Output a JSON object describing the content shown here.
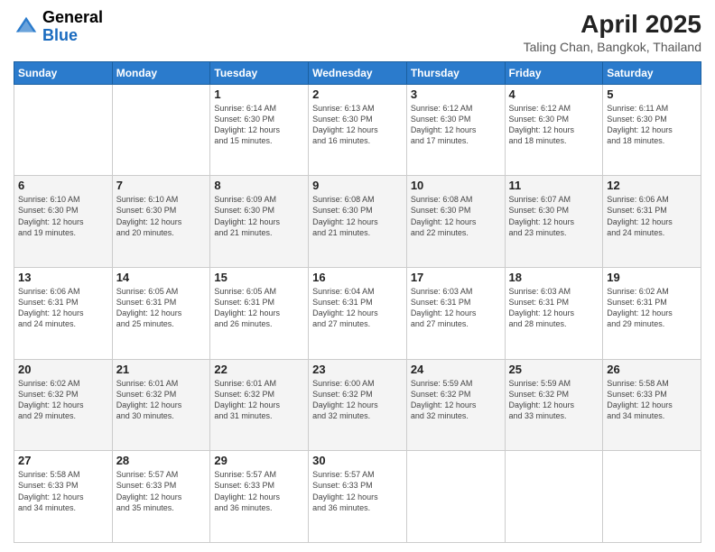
{
  "header": {
    "logo_line1": "General",
    "logo_line2": "Blue",
    "title": "April 2025",
    "subtitle": "Taling Chan, Bangkok, Thailand"
  },
  "days_of_week": [
    "Sunday",
    "Monday",
    "Tuesday",
    "Wednesday",
    "Thursday",
    "Friday",
    "Saturday"
  ],
  "weeks": [
    [
      {
        "day": "",
        "info": ""
      },
      {
        "day": "",
        "info": ""
      },
      {
        "day": "1",
        "info": "Sunrise: 6:14 AM\nSunset: 6:30 PM\nDaylight: 12 hours\nand 15 minutes."
      },
      {
        "day": "2",
        "info": "Sunrise: 6:13 AM\nSunset: 6:30 PM\nDaylight: 12 hours\nand 16 minutes."
      },
      {
        "day": "3",
        "info": "Sunrise: 6:12 AM\nSunset: 6:30 PM\nDaylight: 12 hours\nand 17 minutes."
      },
      {
        "day": "4",
        "info": "Sunrise: 6:12 AM\nSunset: 6:30 PM\nDaylight: 12 hours\nand 18 minutes."
      },
      {
        "day": "5",
        "info": "Sunrise: 6:11 AM\nSunset: 6:30 PM\nDaylight: 12 hours\nand 18 minutes."
      }
    ],
    [
      {
        "day": "6",
        "info": "Sunrise: 6:10 AM\nSunset: 6:30 PM\nDaylight: 12 hours\nand 19 minutes."
      },
      {
        "day": "7",
        "info": "Sunrise: 6:10 AM\nSunset: 6:30 PM\nDaylight: 12 hours\nand 20 minutes."
      },
      {
        "day": "8",
        "info": "Sunrise: 6:09 AM\nSunset: 6:30 PM\nDaylight: 12 hours\nand 21 minutes."
      },
      {
        "day": "9",
        "info": "Sunrise: 6:08 AM\nSunset: 6:30 PM\nDaylight: 12 hours\nand 21 minutes."
      },
      {
        "day": "10",
        "info": "Sunrise: 6:08 AM\nSunset: 6:30 PM\nDaylight: 12 hours\nand 22 minutes."
      },
      {
        "day": "11",
        "info": "Sunrise: 6:07 AM\nSunset: 6:30 PM\nDaylight: 12 hours\nand 23 minutes."
      },
      {
        "day": "12",
        "info": "Sunrise: 6:06 AM\nSunset: 6:31 PM\nDaylight: 12 hours\nand 24 minutes."
      }
    ],
    [
      {
        "day": "13",
        "info": "Sunrise: 6:06 AM\nSunset: 6:31 PM\nDaylight: 12 hours\nand 24 minutes."
      },
      {
        "day": "14",
        "info": "Sunrise: 6:05 AM\nSunset: 6:31 PM\nDaylight: 12 hours\nand 25 minutes."
      },
      {
        "day": "15",
        "info": "Sunrise: 6:05 AM\nSunset: 6:31 PM\nDaylight: 12 hours\nand 26 minutes."
      },
      {
        "day": "16",
        "info": "Sunrise: 6:04 AM\nSunset: 6:31 PM\nDaylight: 12 hours\nand 27 minutes."
      },
      {
        "day": "17",
        "info": "Sunrise: 6:03 AM\nSunset: 6:31 PM\nDaylight: 12 hours\nand 27 minutes."
      },
      {
        "day": "18",
        "info": "Sunrise: 6:03 AM\nSunset: 6:31 PM\nDaylight: 12 hours\nand 28 minutes."
      },
      {
        "day": "19",
        "info": "Sunrise: 6:02 AM\nSunset: 6:31 PM\nDaylight: 12 hours\nand 29 minutes."
      }
    ],
    [
      {
        "day": "20",
        "info": "Sunrise: 6:02 AM\nSunset: 6:32 PM\nDaylight: 12 hours\nand 29 minutes."
      },
      {
        "day": "21",
        "info": "Sunrise: 6:01 AM\nSunset: 6:32 PM\nDaylight: 12 hours\nand 30 minutes."
      },
      {
        "day": "22",
        "info": "Sunrise: 6:01 AM\nSunset: 6:32 PM\nDaylight: 12 hours\nand 31 minutes."
      },
      {
        "day": "23",
        "info": "Sunrise: 6:00 AM\nSunset: 6:32 PM\nDaylight: 12 hours\nand 32 minutes."
      },
      {
        "day": "24",
        "info": "Sunrise: 5:59 AM\nSunset: 6:32 PM\nDaylight: 12 hours\nand 32 minutes."
      },
      {
        "day": "25",
        "info": "Sunrise: 5:59 AM\nSunset: 6:32 PM\nDaylight: 12 hours\nand 33 minutes."
      },
      {
        "day": "26",
        "info": "Sunrise: 5:58 AM\nSunset: 6:33 PM\nDaylight: 12 hours\nand 34 minutes."
      }
    ],
    [
      {
        "day": "27",
        "info": "Sunrise: 5:58 AM\nSunset: 6:33 PM\nDaylight: 12 hours\nand 34 minutes."
      },
      {
        "day": "28",
        "info": "Sunrise: 5:57 AM\nSunset: 6:33 PM\nDaylight: 12 hours\nand 35 minutes."
      },
      {
        "day": "29",
        "info": "Sunrise: 5:57 AM\nSunset: 6:33 PM\nDaylight: 12 hours\nand 36 minutes."
      },
      {
        "day": "30",
        "info": "Sunrise: 5:57 AM\nSunset: 6:33 PM\nDaylight: 12 hours\nand 36 minutes."
      },
      {
        "day": "",
        "info": ""
      },
      {
        "day": "",
        "info": ""
      },
      {
        "day": "",
        "info": ""
      }
    ]
  ]
}
